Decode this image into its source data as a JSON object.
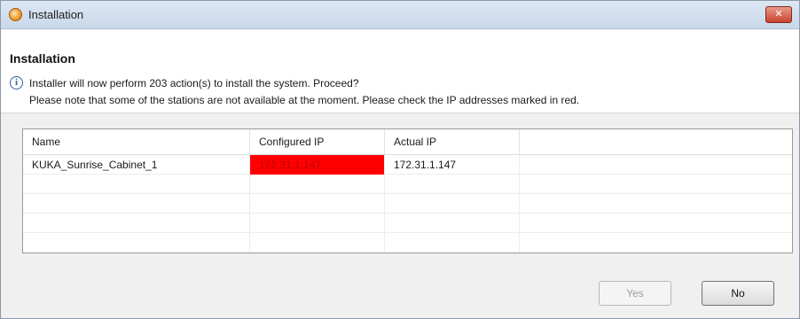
{
  "window": {
    "title": "Installation",
    "close_label": "✕"
  },
  "dialog": {
    "title": "Installation",
    "message_line1": "Installer will now perform 203 action(s) to install the system. Proceed?",
    "message_line2": "Please note that some of the stations are not available at the moment. Please check the IP addresses marked in red.",
    "info_icon": "i"
  },
  "table": {
    "columns": [
      "Name",
      "Configured IP",
      "Actual IP",
      ""
    ],
    "rows": [
      {
        "name": "KUKA_Sunrise_Cabinet_1",
        "configured_ip": "172.31.1.147",
        "actual_ip": "172.31.1.147",
        "highlight_color": "#ff0000"
      }
    ]
  },
  "buttons": {
    "yes_label": "Yes",
    "no_label": "No",
    "yes_enabled": false
  }
}
